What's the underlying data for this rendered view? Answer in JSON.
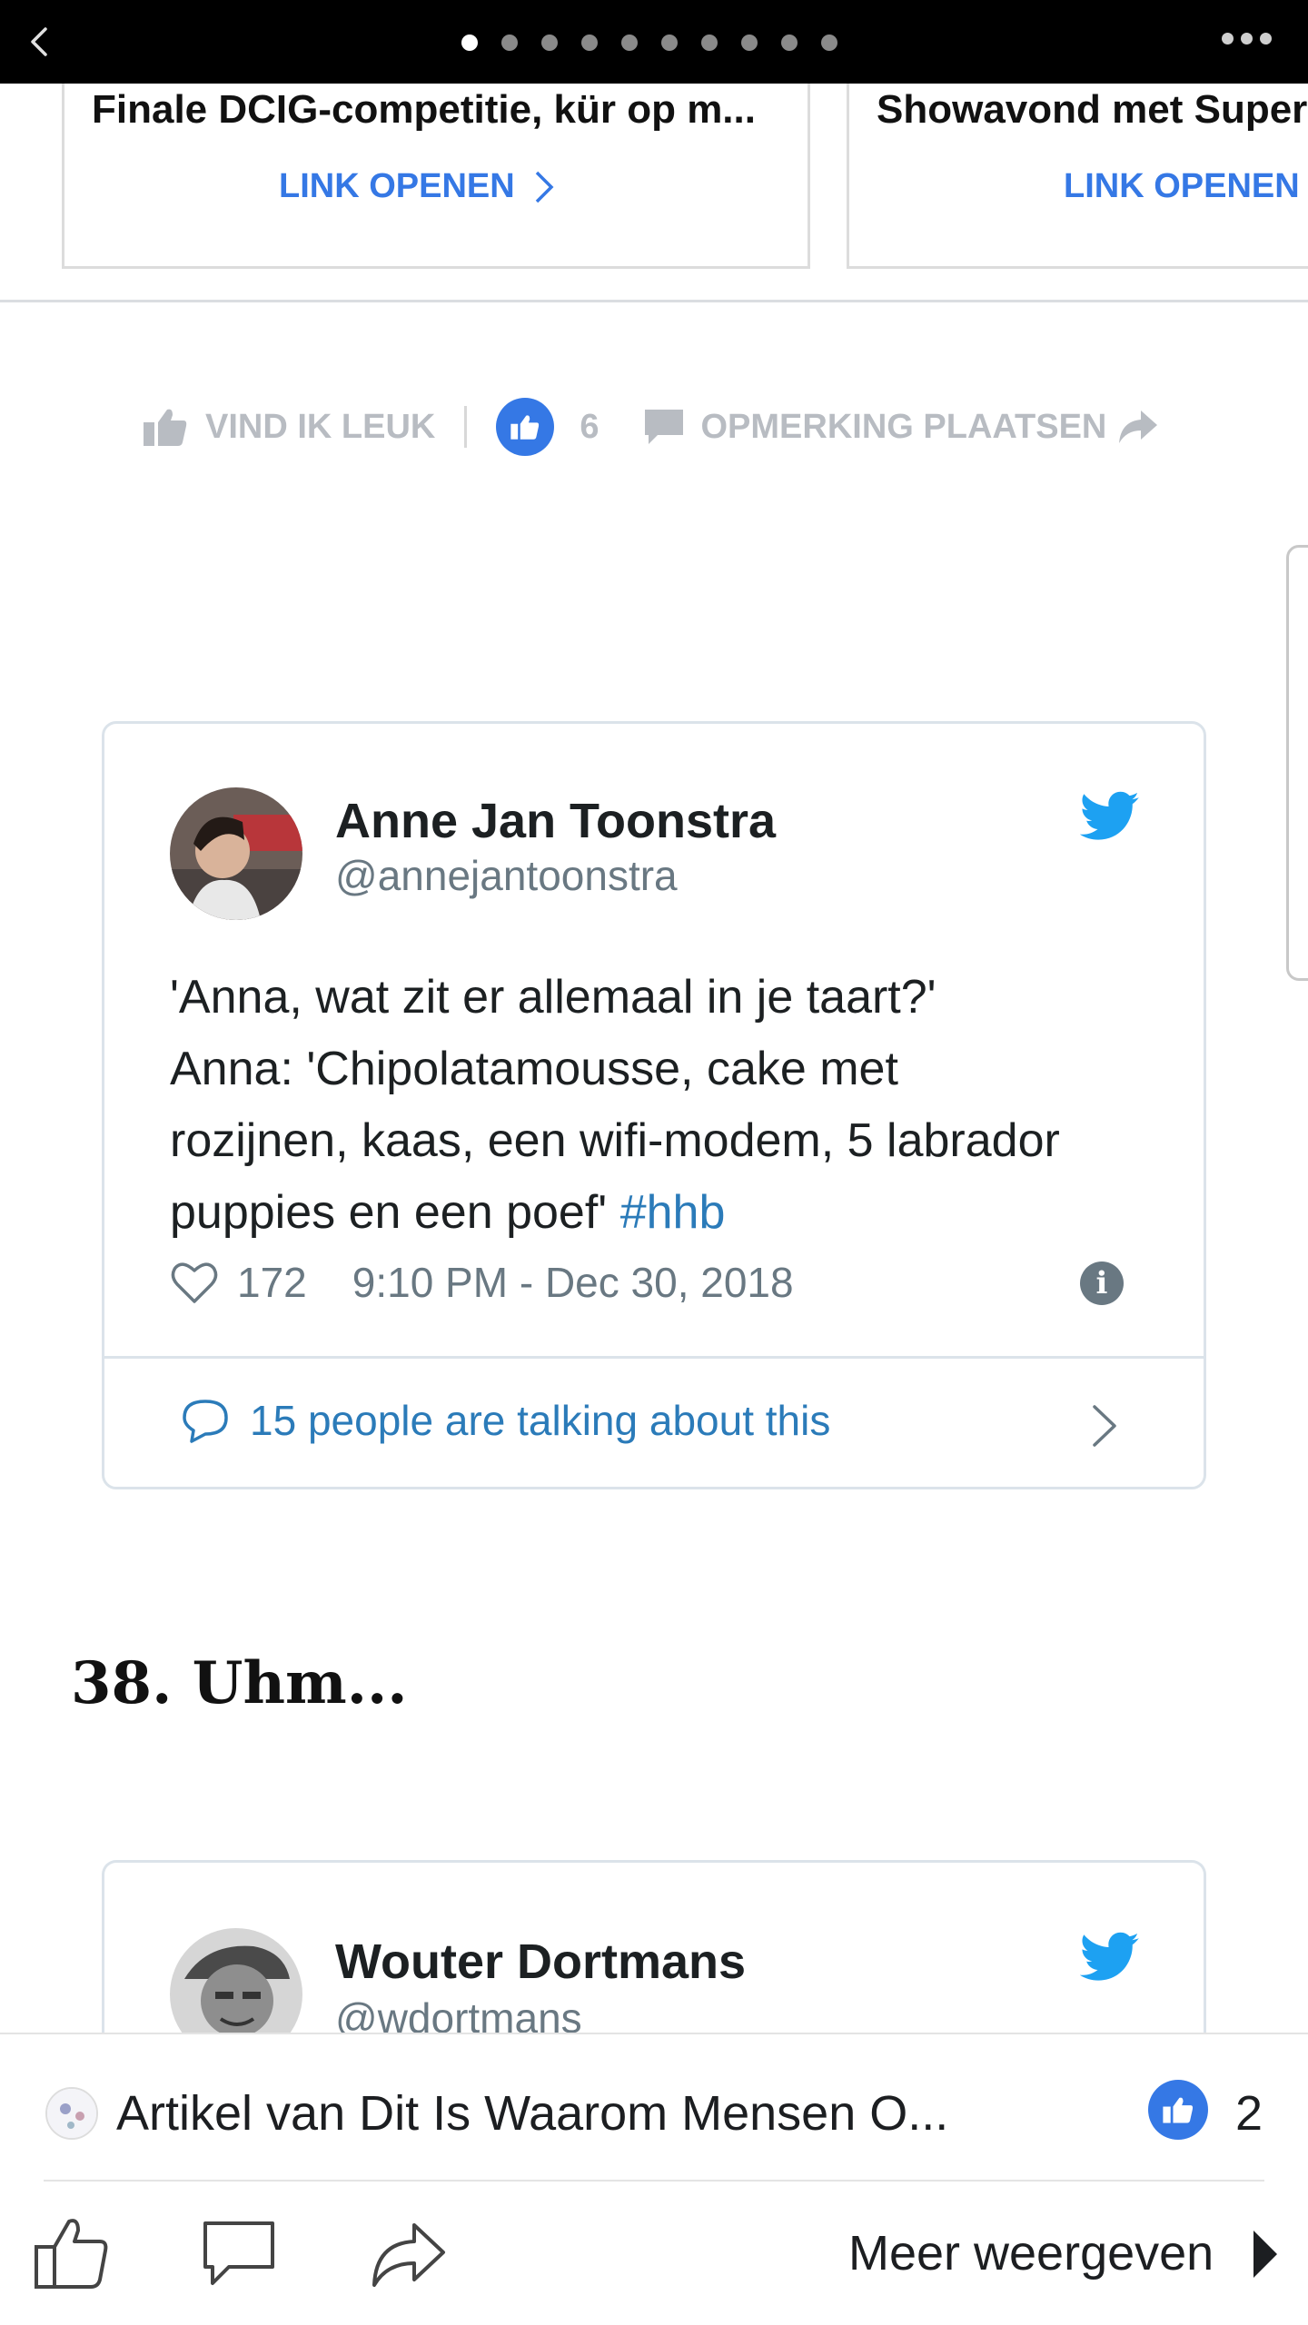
{
  "topbar": {
    "back_icon": "chevron-left-icon",
    "page_dots_total": 10,
    "page_dots_active": 1,
    "more_icon": "more-horizontal-icon"
  },
  "link_cards": [
    {
      "title": "Finale DCIG-competitie, kür op m...",
      "link_label": "LINK OPENEN"
    },
    {
      "title": "Showavond met Super",
      "link_label": "LINK OPENEN"
    }
  ],
  "reactions": {
    "like_label": "VIND IK LEUK",
    "like_count": "6",
    "comment_label": "OPMERKING PLAATSEN"
  },
  "tweet1": {
    "name": "Anne Jan Toonstra",
    "handle": "@annejantoonstra",
    "text_lines": [
      "'Anna, wat zit er allemaal in je taart?'",
      "Anna: 'Chipolatamousse, cake met",
      "rozijnen, kaas, een wifi-modem, 5 labrador",
      "puppies en een poef'"
    ],
    "hashtag": "#hhb",
    "likes": "172",
    "timestamp": "9:10 PM - Dec 30, 2018",
    "talking": "15 people are talking about this"
  },
  "section_heading": "38. Uhm...",
  "tweet2": {
    "name": "Wouter Dortmans",
    "handle": "@wdortmans"
  },
  "bottom": {
    "article_title": "Artikel van Dit Is Waarom Mensen O...",
    "like_count": "2",
    "more_label": "Meer weergeven"
  },
  "colors": {
    "facebook_blue": "#3578e5",
    "twitter_blue": "#1da1f2",
    "twitter_link": "#2b7bb9",
    "muted_gray": "#b8bcc2"
  }
}
